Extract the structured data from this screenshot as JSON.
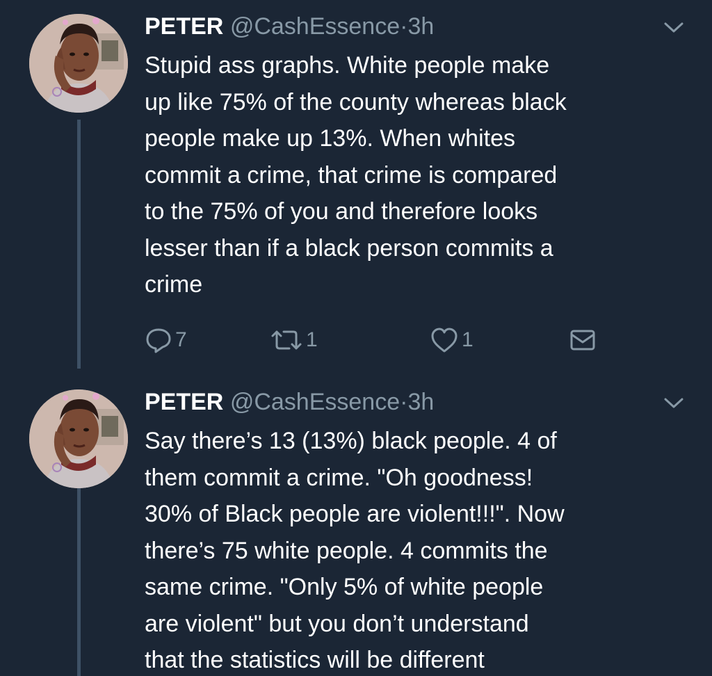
{
  "tweets": [
    {
      "author_name": "PETER",
      "handle": "@CashEssence",
      "separator": "·",
      "time": "3h",
      "text_lines": [
        "Stupid ass graphs. White people make",
        "up like 75% of the county whereas black",
        "people make up 13%. When whites",
        "commit a crime, that crime is compared",
        "to the 75% of you and therefore looks",
        "lesser than if a black person commits a",
        "crime"
      ],
      "replies": "7",
      "retweets": "1",
      "likes": "1"
    },
    {
      "author_name": "PETER",
      "handle": "@CashEssence",
      "separator": "·",
      "time": "3h",
      "text_lines": [
        "Say there’s 13 (13%) black people. 4 of",
        "them commit a crime. \"Oh goodness!",
        "30% of Black people are violent!!!\". Now",
        "there’s 75 white people. 4 commits the",
        "same crime. \"Only 5% of white people",
        "are violent\" but you don’t understand",
        "that the statistics will be different"
      ]
    }
  ],
  "colors": {
    "background": "#1b2635",
    "text": "#ffffff",
    "muted": "#8899a6",
    "thread_line": "#3e5166"
  },
  "icons": {
    "reply": "reply-icon",
    "retweet": "retweet-icon",
    "like": "heart-icon",
    "dm": "envelope-icon",
    "more": "chevron-down-icon"
  }
}
